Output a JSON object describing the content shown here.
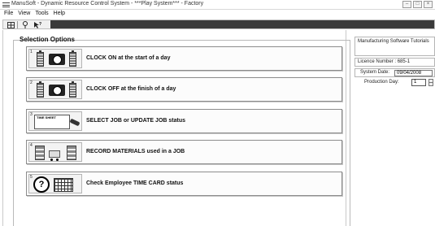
{
  "window": {
    "title": "ManuSoft - Dynamic Resource Control System - ***Play System*** - Factory",
    "buttons": [
      "minimize",
      "maximize",
      "close"
    ]
  },
  "menu": [
    "File",
    "View",
    "Tools",
    "Help"
  ],
  "toolbar": {
    "icons": [
      "grid-icon",
      "tool-icon",
      "help-pointer-icon"
    ]
  },
  "selection": {
    "title": "Selection Options",
    "options": [
      {
        "number": "1",
        "label": "CLOCK ON at the start of a day",
        "icon": "clock-on-icon"
      },
      {
        "number": "2",
        "label": "CLOCK OFF at the finish of a day",
        "icon": "clock-off-icon"
      },
      {
        "number": "3",
        "label": "SELECT JOB or UPDATE JOB status",
        "icon": "timesheet-icon",
        "icon_text": "TIME SHEET"
      },
      {
        "number": "4",
        "label": "RECORD MATERIALS used in a JOB",
        "icon": "materials-icon"
      },
      {
        "number": "5",
        "label": "Check Employee TIME CARD status",
        "icon": "timecard-icon",
        "icon_text": "?"
      }
    ]
  },
  "sidebar": {
    "company": "Manufacturing Software Tutorials",
    "licence": "Licence Number : 685-1",
    "system_date_label": "System Date:",
    "system_date": "09/04/2008",
    "production_day_label": "Production Day:",
    "production_day": "1"
  }
}
